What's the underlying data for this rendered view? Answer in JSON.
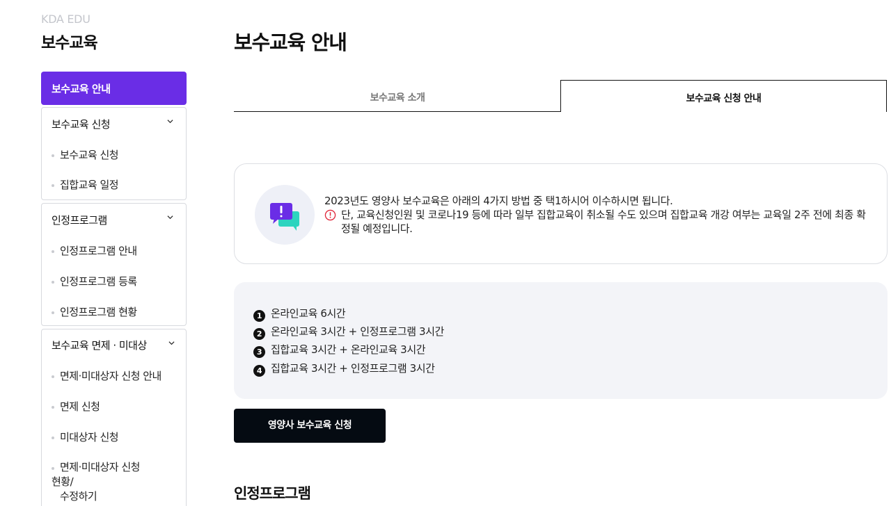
{
  "brand": {
    "sub": "KDA EDU",
    "title": "보수교육"
  },
  "sidebar": {
    "active": "보수교육 안내",
    "groups": [
      {
        "label": "보수교육 신청",
        "items": [
          "보수교육 신청",
          "집합교육 일정"
        ]
      },
      {
        "label": "인정프로그램",
        "items": [
          "인정프로그램 안내",
          "인정프로그램 등록",
          "인정프로그램 현황"
        ]
      },
      {
        "label": "보수교육 면제 · 미대상",
        "items": [
          "면제·미대상자 신청 안내",
          "면제 신청",
          "미대상자 신청",
          "면제·미대상자 신청 현황/ 수정하기"
        ]
      }
    ],
    "last_item_lines": [
      "면제·미대상자 신청",
      "현황/",
      "수정하기"
    ]
  },
  "main": {
    "title": "보수교육 안내",
    "tabs": [
      {
        "label": "보수교육 소개",
        "active": false
      },
      {
        "label": "보수교육 신청 안내",
        "active": true
      }
    ],
    "notice": {
      "line1": "2023년도 영양사 보수교육은 아래의 4가지 방법 중 택1하시어 이수하시면 됩니다.",
      "line2": "단, 교육신청인원 및 코로나19 등에 따라 일부 집합교육이 취소될 수도 있으며 집합교육 개강 여부는 교육일 2주 전에 최종 확정될 예정입니다."
    },
    "options": [
      {
        "num": "1",
        "text": "온라인교육 6시간"
      },
      {
        "num": "2",
        "text": "온라인교육 3시간 + 인정프로그램 3시간"
      },
      {
        "num": "3",
        "text": "집합교육 3시간 + 온라인교육 3시간"
      },
      {
        "num": "4",
        "text": "집합교육 3시간 + 인정프로그램 3시간"
      }
    ],
    "apply_button": "영양사 보수교육 신청",
    "section_title": "인정프로그램"
  },
  "colors": {
    "accent": "#6a2de6",
    "button": "#050b12",
    "panel": "#f3f4f8"
  }
}
